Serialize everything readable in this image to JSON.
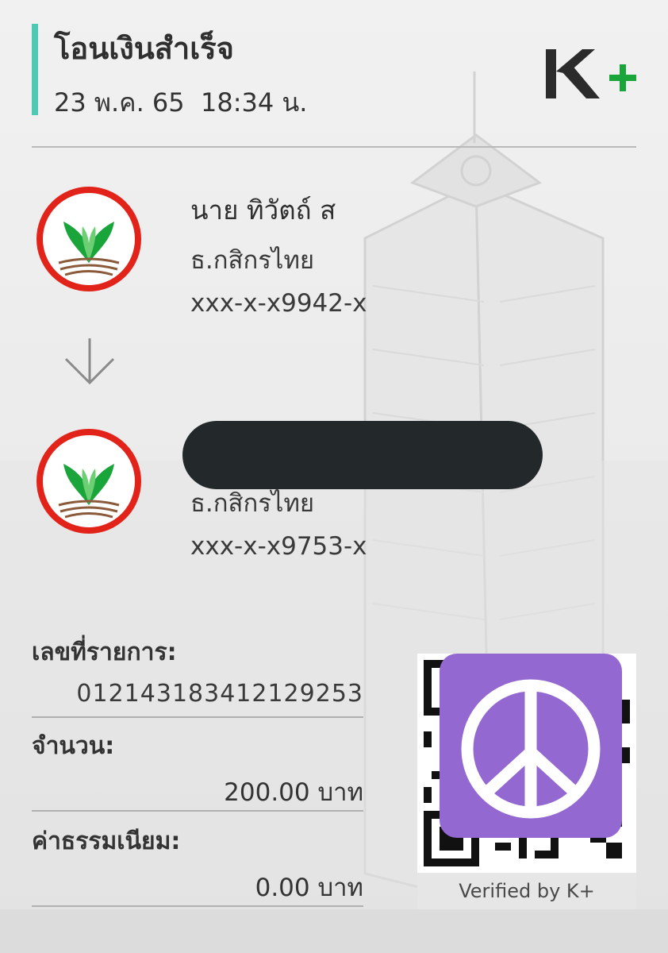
{
  "header": {
    "title": "โอนเงินสำเร็จ",
    "datetime": "23 พ.ค. 65  18:34 น.",
    "logo_text": "K+"
  },
  "sender": {
    "name": "นาย ทิวัตถ์ ส",
    "bank": "ธ.กสิกรไทย",
    "account": "xxx-x-x9942-x"
  },
  "receiver": {
    "name": "",
    "bank": "ธ.กสิกรไทย",
    "account": "xxx-x-x9753-x"
  },
  "details": {
    "ref_label": "เลขที่รายการ:",
    "ref_value": "012143183412129253",
    "amount_label": "จำนวน:",
    "amount_value": "200.00 บาท",
    "fee_label": "ค่าธรรมเนียม:",
    "fee_value": "0.00 บาท"
  },
  "qr": {
    "verified_text": "Verified by K+",
    "overlay_icon": "peace-icon"
  },
  "colors": {
    "accent": "#4ec9b3",
    "kbank_green": "#1aa53b",
    "kbank_red": "#e2231a",
    "overlay_purple": "#9468d1",
    "redaction": "#23292b"
  }
}
